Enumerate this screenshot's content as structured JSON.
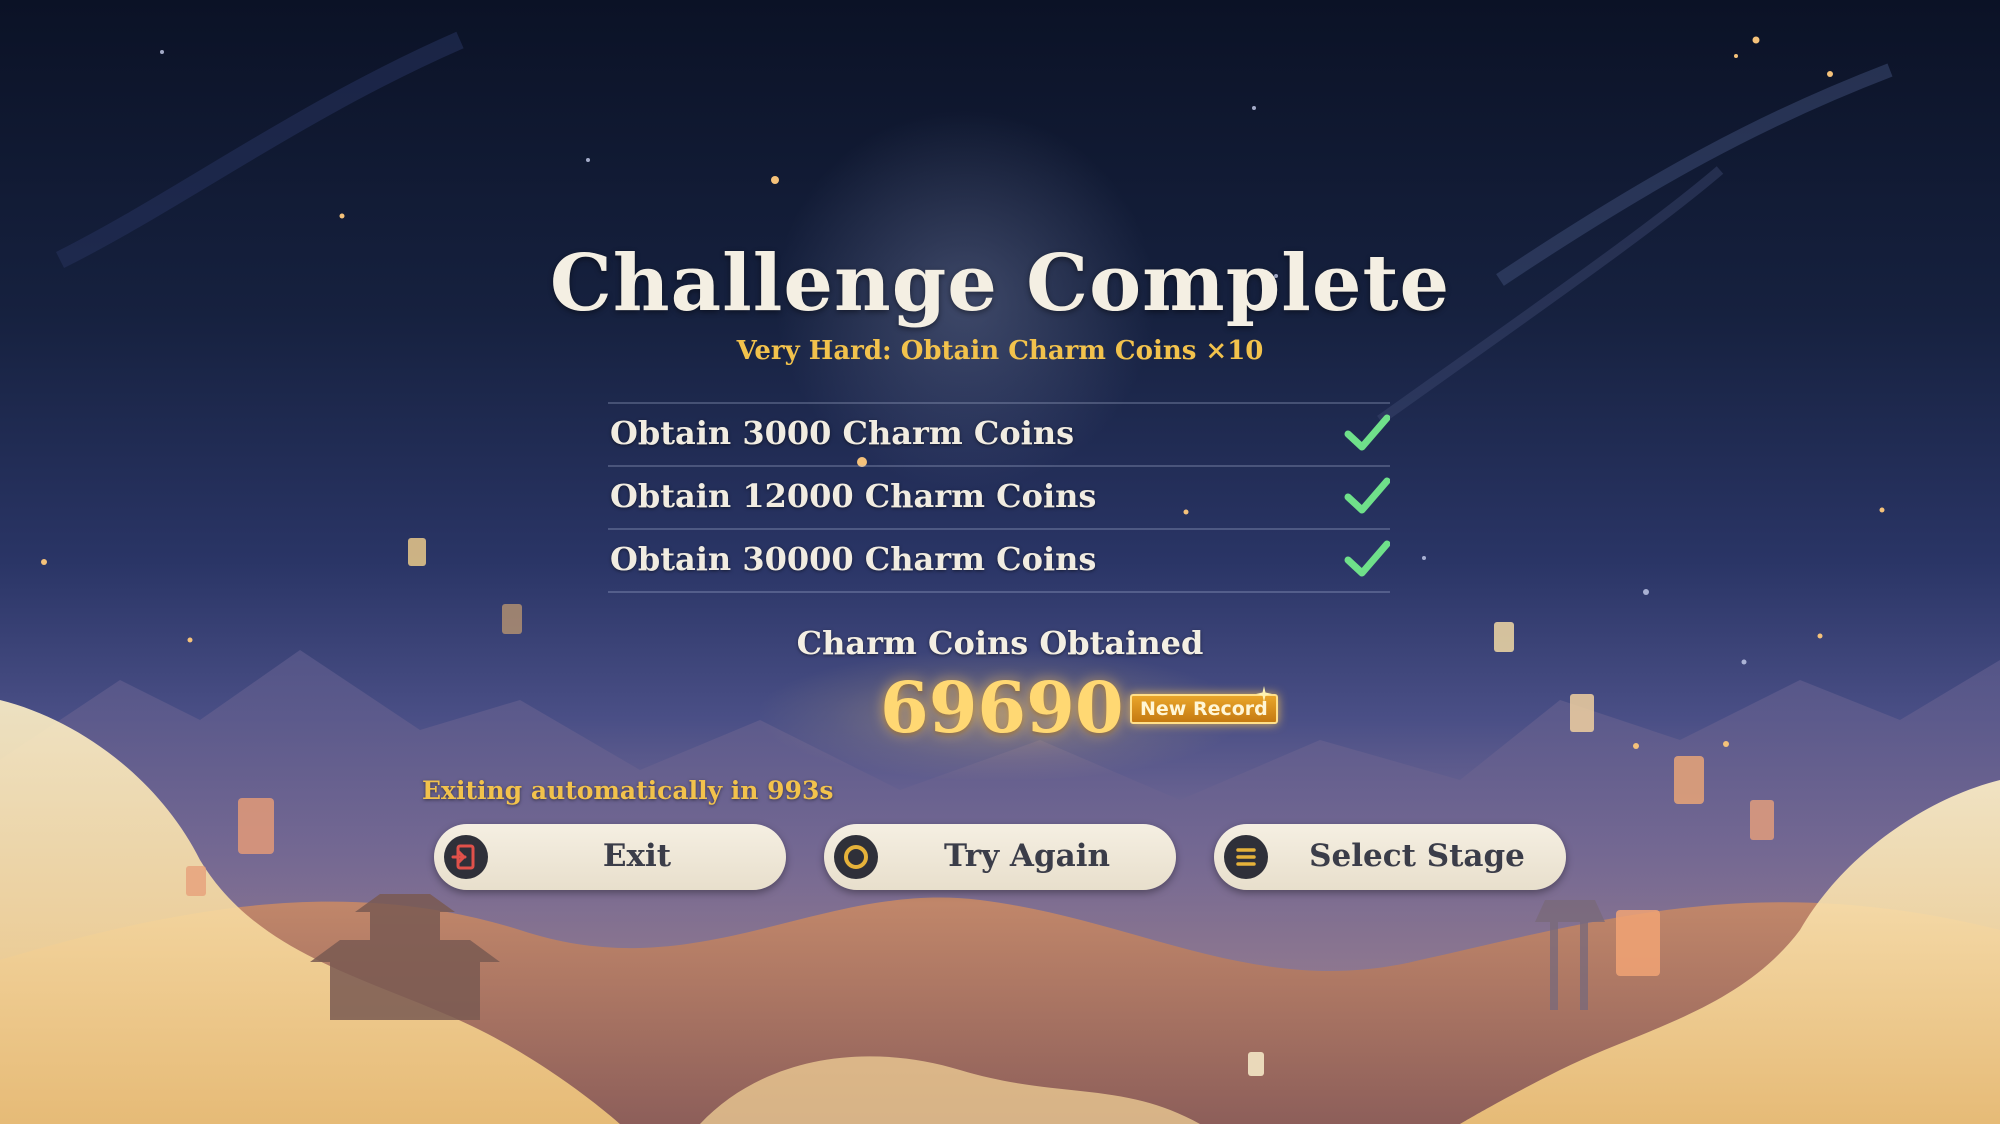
{
  "result": {
    "title": "Challenge Complete",
    "subtitle": "Very Hard: Obtain Charm Coins ×10"
  },
  "objectives": [
    {
      "label": "Obtain 3000 Charm Coins",
      "completed": true
    },
    {
      "label": "Obtain 12000 Charm Coins",
      "completed": true
    },
    {
      "label": "Obtain 30000 Charm Coins",
      "completed": true
    }
  ],
  "score": {
    "label": "Charm Coins Obtained",
    "value": "69690",
    "badge": "New Record"
  },
  "auto_exit": {
    "text": "Exiting automatically in 993s"
  },
  "buttons": {
    "exit": {
      "label": "Exit",
      "icon": "exit-door-icon"
    },
    "try_again": {
      "label": "Try Again",
      "icon": "circle-icon"
    },
    "select_stage": {
      "label": "Select Stage",
      "icon": "menu-lines-icon"
    }
  },
  "colors": {
    "accent_gold": "#f2c24c",
    "check_green": "#6fe08a",
    "button_bg": "#f1eadb",
    "exit_icon_red": "#e0514a"
  }
}
